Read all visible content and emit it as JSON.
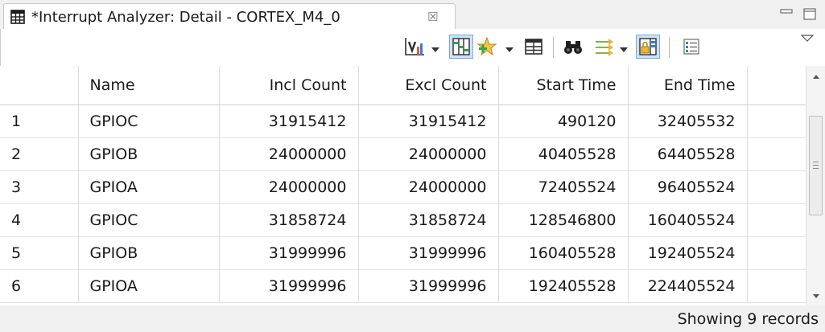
{
  "tab": {
    "title": "*Interrupt Analyzer: Detail - CORTEX_M4_0",
    "close_glyph": "☒",
    "icon": "table-grid-icon"
  },
  "window_controls": {
    "minimize": "minimize-icon",
    "maximize": "maximize-icon"
  },
  "toolbar": {
    "icons": [
      "chart-icon",
      "columns-icon",
      "star-plus-icon",
      "table-columns-icon",
      "binoculars-icon",
      "filter-arrows-icon",
      "lock-columns-icon",
      "settings-list-icon",
      "view-menu-icon"
    ]
  },
  "table": {
    "headers": [
      "",
      "Name",
      "Incl Count",
      "Excl Count",
      "Start Time",
      "End Time",
      ""
    ],
    "rows": [
      [
        "1",
        "GPIOC",
        "31915412",
        "31915412",
        "490120",
        "32405532"
      ],
      [
        "2",
        "GPIOB",
        "24000000",
        "24000000",
        "40405528",
        "64405528"
      ],
      [
        "3",
        "GPIOA",
        "24000000",
        "24000000",
        "72405524",
        "96405524"
      ],
      [
        "4",
        "GPIOC",
        "31858724",
        "31858724",
        "128546800",
        "160405524"
      ],
      [
        "5",
        "GPIOB",
        "31999996",
        "31999996",
        "160405528",
        "192405524"
      ],
      [
        "6",
        "GPIOA",
        "31999996",
        "31999996",
        "192405528",
        "224405524"
      ]
    ]
  },
  "status": {
    "text": "Showing 9 records"
  },
  "colors": {
    "accent_blue": "#2b6cb0",
    "selected_toggle": "#cde3f7"
  }
}
